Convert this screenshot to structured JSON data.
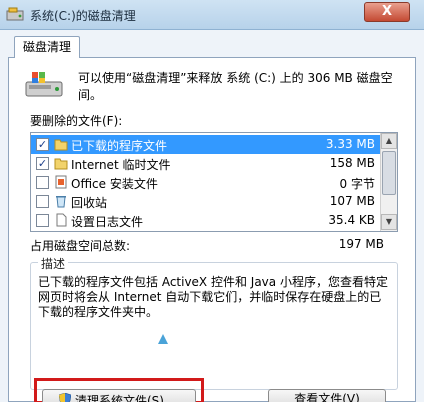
{
  "window": {
    "title": "系统(C:)的磁盘清理",
    "close_label": "X"
  },
  "tab": {
    "label": "磁盘清理"
  },
  "intro": {
    "text": "可以使用“磁盘清理”来释放 系统 (C:) 上的 306 MB 磁盘空间。"
  },
  "file_list": {
    "label": "要删除的文件(F):",
    "items": [
      {
        "name": "已下载的程序文件",
        "size": "3.33 MB",
        "checked": "✓",
        "selected": true,
        "icon": "folder-icon"
      },
      {
        "name": "Internet 临时文件",
        "size": "158 MB",
        "checked": "✓",
        "selected": false,
        "icon": "folder-icon"
      },
      {
        "name": "Office 安装文件",
        "size": "0 字节",
        "checked": "",
        "selected": false,
        "icon": "office-icon"
      },
      {
        "name": "回收站",
        "size": "107 MB",
        "checked": "",
        "selected": false,
        "icon": "recycle-bin-icon"
      },
      {
        "name": "设置日志文件",
        "size": "35.4 KB",
        "checked": "",
        "selected": false,
        "icon": "document-icon"
      }
    ]
  },
  "total": {
    "label": "占用磁盘空间总数:",
    "value": "197 MB"
  },
  "description": {
    "label": "描述",
    "text": "已下载的程序文件包括 ActiveX 控件和 Java 小程序，您查看特定网页时将会从 Internet 自动下载它们，并临时保存在硬盘上的已下载的程序文件夹中。"
  },
  "buttons": {
    "cleanup_system_files": "清理系统文件(S)",
    "view_files": "查看文件(V)"
  },
  "colors": {
    "selection": "#3399ff",
    "highlight_box": "#d21a1a",
    "title_gradient_top": "#cfe3f3"
  }
}
